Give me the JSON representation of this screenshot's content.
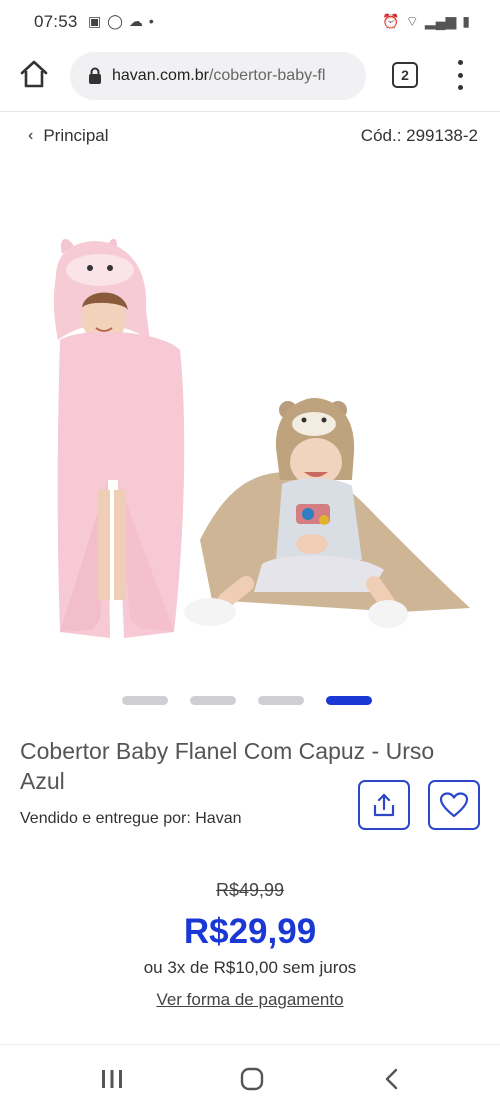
{
  "status_bar": {
    "time": "07:53",
    "left_icons": [
      "image-icon",
      "whatsapp-icon",
      "cloud-icon",
      "dot-icon"
    ],
    "right_icons": [
      "alarm-icon",
      "wifi-icon",
      "signal-icon",
      "battery-icon"
    ]
  },
  "browser": {
    "url_domain": "havan.com.br",
    "url_path": "/cobertor-baby-fl",
    "tab_count": "2"
  },
  "breadcrumb": {
    "back_label": "Principal",
    "product_code": "Cód.: 299138-2"
  },
  "carousel": {
    "total": 4,
    "active_index": 3
  },
  "product": {
    "title": "Cobertor Baby Flanel Com Capuz - Urso Azul",
    "seller": "Vendido e entregue por: Havan",
    "old_price": "R$49,99",
    "price": "R$29,99",
    "installments": "ou 3x de R$10,00 sem juros",
    "payment_link": "Ver forma de pagamento"
  },
  "colors": {
    "accent": "#1a39d4",
    "pink_blanket": "#f6c9d4",
    "tan_blanket": "#cdb596"
  }
}
